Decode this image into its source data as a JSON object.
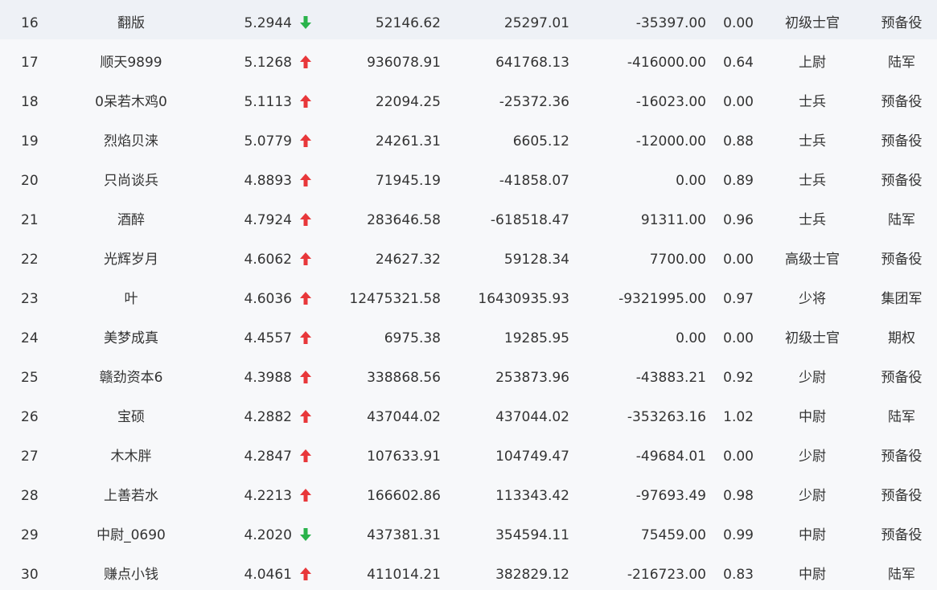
{
  "colors": {
    "up": "#e8373a",
    "down": "#2ab34b",
    "text": "#333333",
    "background": "#f7f8fa"
  },
  "rows": [
    {
      "rank": "16",
      "name": "翻版",
      "score": "5.2944",
      "trend": "down",
      "value1": "52146.62",
      "value2": "25297.01",
      "value3": "-35397.00",
      "ratio": "0.00",
      "title": "初级士官",
      "category": "预备役"
    },
    {
      "rank": "17",
      "name": "顺天9899",
      "score": "5.1268",
      "trend": "up",
      "value1": "936078.91",
      "value2": "641768.13",
      "value3": "-416000.00",
      "ratio": "0.64",
      "title": "上尉",
      "category": "陆军"
    },
    {
      "rank": "18",
      "name": "0呆若木鸡0",
      "score": "5.1113",
      "trend": "up",
      "value1": "22094.25",
      "value2": "-25372.36",
      "value3": "-16023.00",
      "ratio": "0.00",
      "title": "士兵",
      "category": "预备役"
    },
    {
      "rank": "19",
      "name": "烈焰贝涞",
      "score": "5.0779",
      "trend": "up",
      "value1": "24261.31",
      "value2": "6605.12",
      "value3": "-12000.00",
      "ratio": "0.88",
      "title": "士兵",
      "category": "预备役"
    },
    {
      "rank": "20",
      "name": "只尚谈兵",
      "score": "4.8893",
      "trend": "up",
      "value1": "71945.19",
      "value2": "-41858.07",
      "value3": "0.00",
      "ratio": "0.89",
      "title": "士兵",
      "category": "预备役"
    },
    {
      "rank": "21",
      "name": "酒醉",
      "score": "4.7924",
      "trend": "up",
      "value1": "283646.58",
      "value2": "-618518.47",
      "value3": "91311.00",
      "ratio": "0.96",
      "title": "士兵",
      "category": "陆军"
    },
    {
      "rank": "22",
      "name": "光辉岁月",
      "score": "4.6062",
      "trend": "up",
      "value1": "24627.32",
      "value2": "59128.34",
      "value3": "7700.00",
      "ratio": "0.00",
      "title": "高级士官",
      "category": "预备役"
    },
    {
      "rank": "23",
      "name": "叶",
      "score": "4.6036",
      "trend": "up",
      "value1": "12475321.58",
      "value2": "16430935.93",
      "value3": "-9321995.00",
      "ratio": "0.97",
      "title": "少将",
      "category": "集团军"
    },
    {
      "rank": "24",
      "name": "美梦成真",
      "score": "4.4557",
      "trend": "up",
      "value1": "6975.38",
      "value2": "19285.95",
      "value3": "0.00",
      "ratio": "0.00",
      "title": "初级士官",
      "category": "期权"
    },
    {
      "rank": "25",
      "name": "赣劲资本6",
      "score": "4.3988",
      "trend": "up",
      "value1": "338868.56",
      "value2": "253873.96",
      "value3": "-43883.21",
      "ratio": "0.92",
      "title": "少尉",
      "category": "预备役"
    },
    {
      "rank": "26",
      "name": "宝硕",
      "score": "4.2882",
      "trend": "up",
      "value1": "437044.02",
      "value2": "437044.02",
      "value3": "-353263.16",
      "ratio": "1.02",
      "title": "中尉",
      "category": "陆军"
    },
    {
      "rank": "27",
      "name": "木木胖",
      "score": "4.2847",
      "trend": "up",
      "value1": "107633.91",
      "value2": "104749.47",
      "value3": "-49684.01",
      "ratio": "0.00",
      "title": "少尉",
      "category": "预备役"
    },
    {
      "rank": "28",
      "name": "上善若水",
      "score": "4.2213",
      "trend": "up",
      "value1": "166602.86",
      "value2": "113343.42",
      "value3": "-97693.49",
      "ratio": "0.98",
      "title": "少尉",
      "category": "预备役"
    },
    {
      "rank": "29",
      "name": "中尉_0690",
      "score": "4.2020",
      "trend": "down",
      "value1": "437381.31",
      "value2": "354594.11",
      "value3": "75459.00",
      "ratio": "0.99",
      "title": "中尉",
      "category": "预备役"
    },
    {
      "rank": "30",
      "name": "赚点小钱",
      "score": "4.0461",
      "trend": "up",
      "value1": "411014.21",
      "value2": "382829.12",
      "value3": "-216723.00",
      "ratio": "0.83",
      "title": "中尉",
      "category": "陆军"
    }
  ]
}
